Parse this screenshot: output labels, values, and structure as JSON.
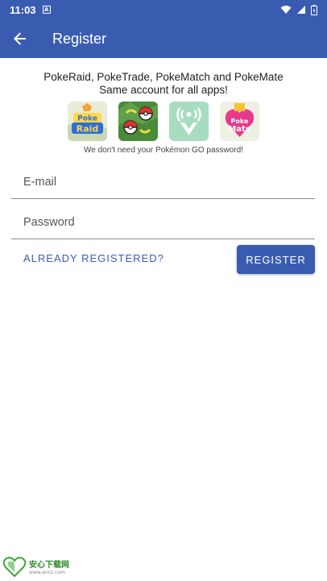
{
  "status_bar": {
    "time": "11:03",
    "sim_glyph": "A",
    "icons": [
      "wifi-icon",
      "signal-icon",
      "battery-icon"
    ]
  },
  "app_bar": {
    "title": "Register",
    "back_icon": "arrow-left-icon"
  },
  "intro": {
    "line1": "PokeRaid, PokeTrade, PokeMatch and PokeMate",
    "line2": "Same account for all apps!"
  },
  "app_icons": [
    {
      "name": "PokeRaid",
      "label": "Poke\nRaid"
    },
    {
      "name": "PokeTrade"
    },
    {
      "name": "PokeMatch"
    },
    {
      "name": "PokeMate",
      "label": "Poke\nMate"
    }
  ],
  "disclaimer": "We don't need your Pokémon GO password!",
  "form": {
    "email_placeholder": "E-mail",
    "password_placeholder": "Password",
    "already_registered_label": "ALREADY REGISTERED?",
    "register_label": "REGISTER"
  },
  "watermark": {
    "title": "安心下载网",
    "url": "www.anxz.com"
  },
  "colors": {
    "primary": "#3a5cb0",
    "background": "#ffffff"
  }
}
